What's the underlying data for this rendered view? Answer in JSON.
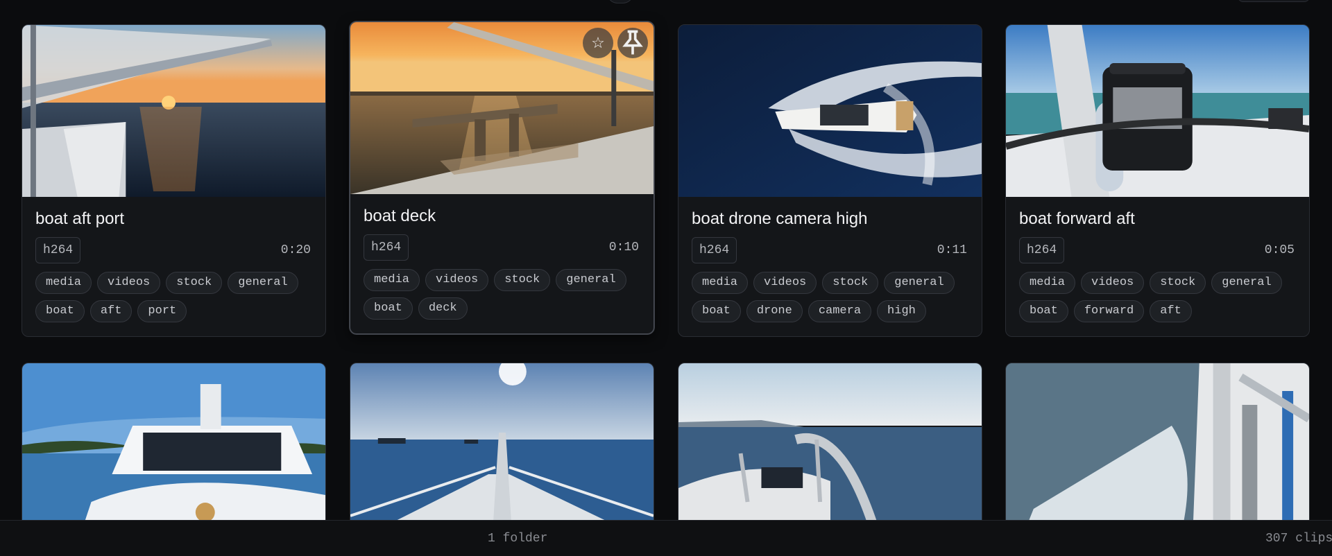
{
  "cards": [
    {
      "title": "boat aft port",
      "codec": "h264",
      "duration": "0:20",
      "tags": [
        "media",
        "videos",
        "stock",
        "general",
        "boat",
        "aft",
        "port"
      ]
    },
    {
      "title": "boat deck",
      "codec": "h264",
      "duration": "0:10",
      "tags": [
        "media",
        "videos",
        "stock",
        "general",
        "boat",
        "deck"
      ]
    },
    {
      "title": "boat drone camera high",
      "codec": "h264",
      "duration": "0:11",
      "tags": [
        "media",
        "videos",
        "stock",
        "general",
        "boat",
        "drone",
        "camera",
        "high"
      ]
    },
    {
      "title": "boat forward aft",
      "codec": "h264",
      "duration": "0:05",
      "tags": [
        "media",
        "videos",
        "stock",
        "general",
        "boat",
        "forward",
        "aft"
      ]
    }
  ],
  "hover_actions": {
    "favorite_icon": "star-outline-icon",
    "pin_icon": "pin-icon"
  },
  "footer": {
    "folders": "1 folder",
    "clips": "307 clips"
  }
}
